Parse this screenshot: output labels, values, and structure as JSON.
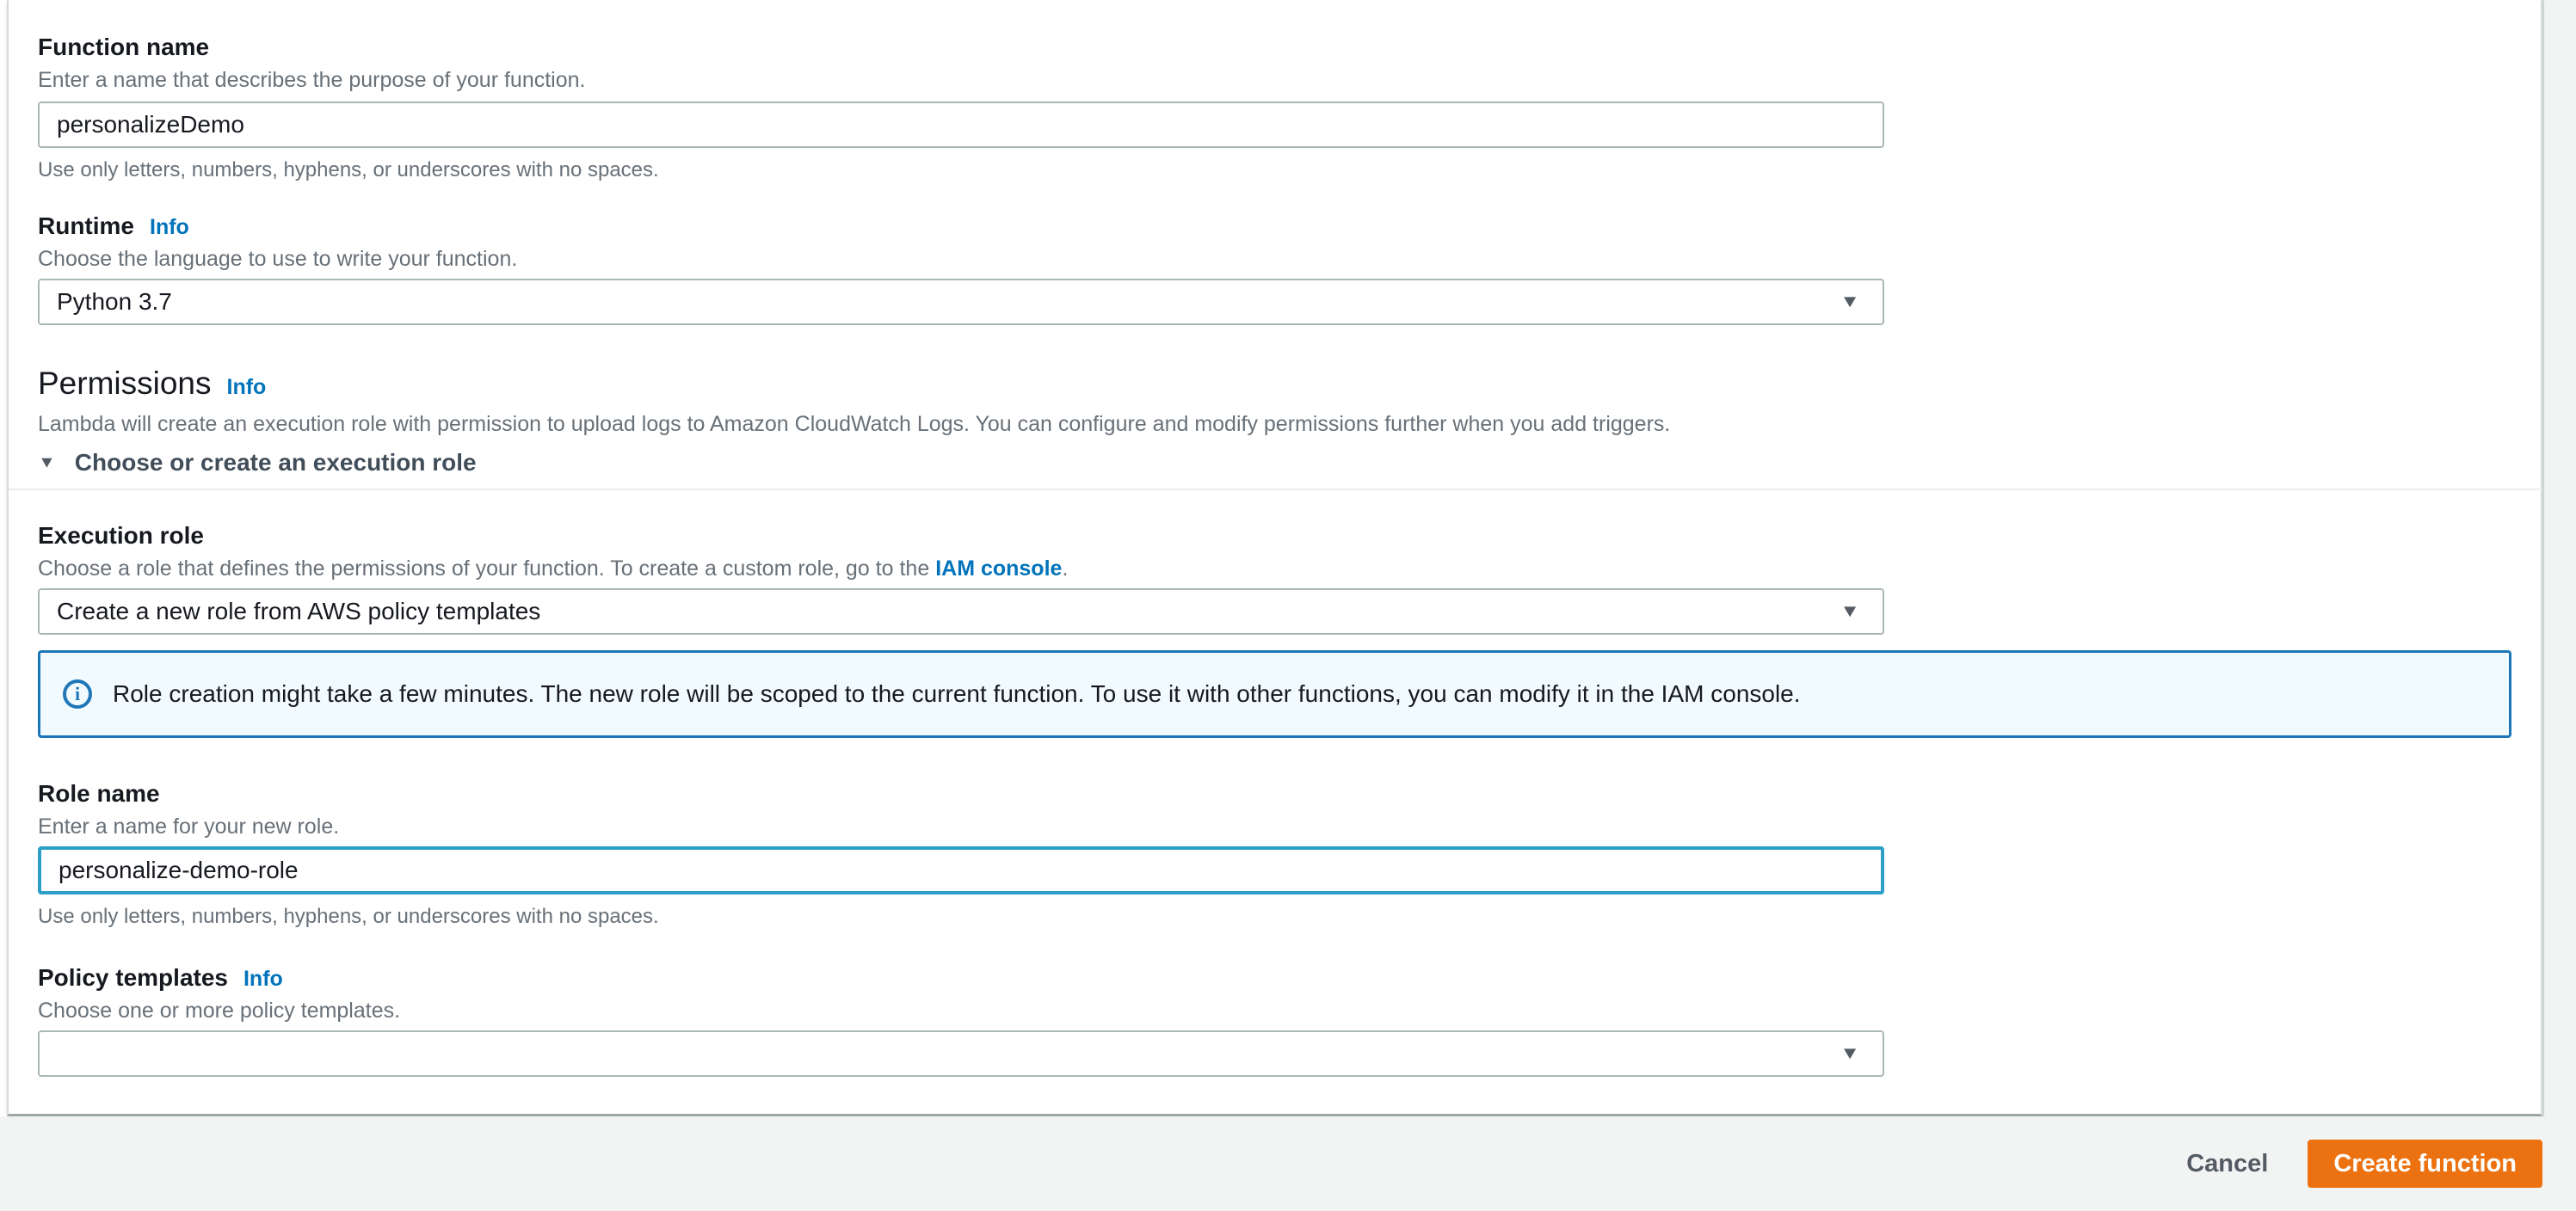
{
  "form": {
    "function_name": {
      "label": "Function name",
      "description": "Enter a name that describes the purpose of your function.",
      "value": "personalizeDemo",
      "constraint": "Use only letters, numbers, hyphens, or underscores with no spaces."
    },
    "runtime": {
      "label": "Runtime",
      "info_link": "Info",
      "description": "Choose the language to use to write your function.",
      "value": "Python 3.7"
    }
  },
  "permissions": {
    "heading": "Permissions",
    "info_link": "Info",
    "description": "Lambda will create an execution role with permission to upload logs to Amazon CloudWatch Logs. You can configure and modify permissions further when you add triggers.",
    "expander_label": "Choose or create an execution role"
  },
  "execution_role": {
    "label": "Execution role",
    "description_prefix": "Choose a role that defines the permissions of your function. To create a custom role, go to the ",
    "description_link": "IAM console",
    "description_suffix": ".",
    "value": "Create a new role from AWS policy templates"
  },
  "role_alert": {
    "message": "Role creation might take a few minutes. The new role will be scoped to the current function. To use it with other functions, you can modify it in the IAM console.",
    "icon_symbol": "i"
  },
  "role_name": {
    "label": "Role name",
    "description": "Enter a name for your new role.",
    "value": "personalize-demo-role",
    "constraint": "Use only letters, numbers, hyphens, or underscores with no spaces."
  },
  "policy_templates": {
    "label": "Policy templates",
    "info_link": "Info",
    "description": "Choose one or more policy templates.",
    "value": ""
  },
  "footer": {
    "cancel_label": "Cancel",
    "submit_label": "Create function"
  },
  "icons": {
    "dropdown_glyph": "▼",
    "expander_glyph": "▼"
  },
  "colors": {
    "accent_orange": "#ec7211",
    "link_blue": "#0073bb",
    "focus_border": "#2b9fc6",
    "input_border": "#aab7b8",
    "alert_border": "#1b77b5",
    "alert_bg": "#f1faff",
    "page_bg": "#f2f3f3"
  }
}
